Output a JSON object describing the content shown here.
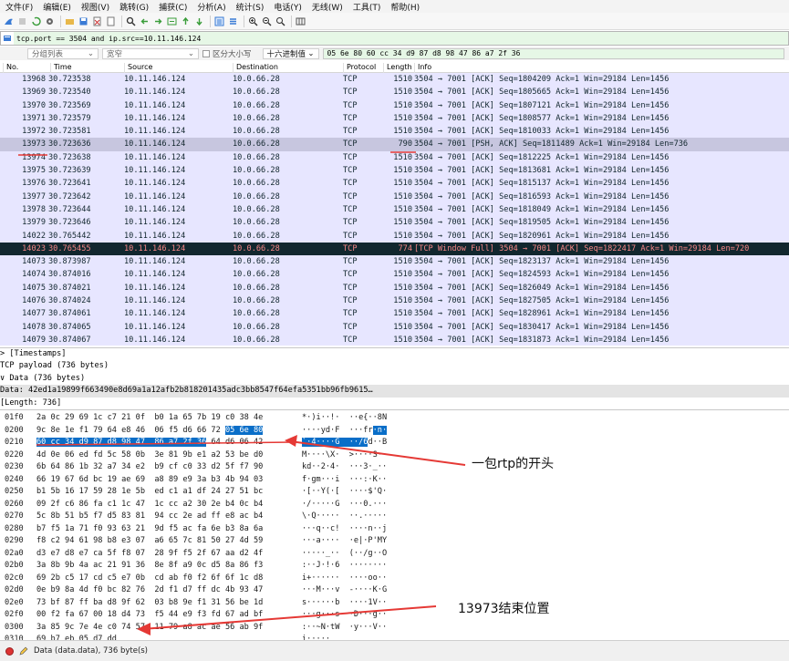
{
  "menu": [
    "文件(F)",
    "编辑(E)",
    "视图(V)",
    "跳转(G)",
    "捕获(C)",
    "分析(A)",
    "统计(S)",
    "电话(Y)",
    "无线(W)",
    "工具(T)",
    "帮助(H)"
  ],
  "toolbar_icons": [
    "shark-fin-icon",
    "stop-icon",
    "restart-icon",
    "options-icon",
    "open-file-icon",
    "save-file-icon",
    "close-file-icon",
    "reload-icon",
    "find-icon",
    "back-icon",
    "forward-icon",
    "jump-icon",
    "first-icon",
    "last-icon",
    "autoscroll-icon",
    "colorize-icon",
    "zoom-in-icon",
    "zoom-out-icon",
    "zoom-reset-icon",
    "resize-columns-icon"
  ],
  "filter": {
    "value": "tcp.port == 3504 and ip.src==10.11.146.124"
  },
  "search": {
    "scope": "分组列表",
    "charset": "宽窄",
    "case_label": "区分大小写",
    "mode": "十六进制值",
    "pattern": "05 6e 80 60 cc 34 d9 87 d8 98 47 86 a7 2f 36"
  },
  "columns": [
    "No.",
    "Time",
    "Source",
    "Destination",
    "Protocol",
    "Length",
    "Info"
  ],
  "packets": [
    {
      "no": "13968",
      "time": "30.723538",
      "src": "10.11.146.124",
      "dst": "10.0.66.28",
      "proto": "TCP",
      "len": "1510",
      "info": "3504 → 7001 [ACK] Seq=1804209 Ack=1 Win=29184 Len=1456",
      "state": "normal"
    },
    {
      "no": "13969",
      "time": "30.723540",
      "src": "10.11.146.124",
      "dst": "10.0.66.28",
      "proto": "TCP",
      "len": "1510",
      "info": "3504 → 7001 [ACK] Seq=1805665 Ack=1 Win=29184 Len=1456",
      "state": "normal"
    },
    {
      "no": "13970",
      "time": "30.723569",
      "src": "10.11.146.124",
      "dst": "10.0.66.28",
      "proto": "TCP",
      "len": "1510",
      "info": "3504 → 7001 [ACK] Seq=1807121 Ack=1 Win=29184 Len=1456",
      "state": "normal"
    },
    {
      "no": "13971",
      "time": "30.723579",
      "src": "10.11.146.124",
      "dst": "10.0.66.28",
      "proto": "TCP",
      "len": "1510",
      "info": "3504 → 7001 [ACK] Seq=1808577 Ack=1 Win=29184 Len=1456",
      "state": "normal"
    },
    {
      "no": "13972",
      "time": "30.723581",
      "src": "10.11.146.124",
      "dst": "10.0.66.28",
      "proto": "TCP",
      "len": "1510",
      "info": "3504 → 7001 [ACK] Seq=1810033 Ack=1 Win=29184 Len=1456",
      "state": "normal"
    },
    {
      "no": "13973",
      "time": "30.723636",
      "src": "10.11.146.124",
      "dst": "10.0.66.28",
      "proto": "TCP",
      "len": "790",
      "info": "3504 → 7001 [PSH, ACK] Seq=1811489 Ack=1 Win=29184 Len=736",
      "state": "selected"
    },
    {
      "no": "13974",
      "time": "30.723638",
      "src": "10.11.146.124",
      "dst": "10.0.66.28",
      "proto": "TCP",
      "len": "1510",
      "info": "3504 → 7001 [ACK] Seq=1812225 Ack=1 Win=29184 Len=1456",
      "state": "normal"
    },
    {
      "no": "13975",
      "time": "30.723639",
      "src": "10.11.146.124",
      "dst": "10.0.66.28",
      "proto": "TCP",
      "len": "1510",
      "info": "3504 → 7001 [ACK] Seq=1813681 Ack=1 Win=29184 Len=1456",
      "state": "normal"
    },
    {
      "no": "13976",
      "time": "30.723641",
      "src": "10.11.146.124",
      "dst": "10.0.66.28",
      "proto": "TCP",
      "len": "1510",
      "info": "3504 → 7001 [ACK] Seq=1815137 Ack=1 Win=29184 Len=1456",
      "state": "normal"
    },
    {
      "no": "13977",
      "time": "30.723642",
      "src": "10.11.146.124",
      "dst": "10.0.66.28",
      "proto": "TCP",
      "len": "1510",
      "info": "3504 → 7001 [ACK] Seq=1816593 Ack=1 Win=29184 Len=1456",
      "state": "normal"
    },
    {
      "no": "13978",
      "time": "30.723644",
      "src": "10.11.146.124",
      "dst": "10.0.66.28",
      "proto": "TCP",
      "len": "1510",
      "info": "3504 → 7001 [ACK] Seq=1818049 Ack=1 Win=29184 Len=1456",
      "state": "normal"
    },
    {
      "no": "13979",
      "time": "30.723646",
      "src": "10.11.146.124",
      "dst": "10.0.66.28",
      "proto": "TCP",
      "len": "1510",
      "info": "3504 → 7001 [ACK] Seq=1819505 Ack=1 Win=29184 Len=1456",
      "state": "normal"
    },
    {
      "no": "14022",
      "time": "30.765442",
      "src": "10.11.146.124",
      "dst": "10.0.66.28",
      "proto": "TCP",
      "len": "1510",
      "info": "3504 → 7001 [ACK] Seq=1820961 Ack=1 Win=29184 Len=1456",
      "state": "normal"
    },
    {
      "no": "14023",
      "time": "30.765455",
      "src": "10.11.146.124",
      "dst": "10.0.66.28",
      "proto": "TCP",
      "len": "774",
      "info": "[TCP Window Full] 3504 → 7001 [ACK] Seq=1822417 Ack=1 Win=29184 Len=720",
      "state": "warning"
    },
    {
      "no": "14073",
      "time": "30.873987",
      "src": "10.11.146.124",
      "dst": "10.0.66.28",
      "proto": "TCP",
      "len": "1510",
      "info": "3504 → 7001 [ACK] Seq=1823137 Ack=1 Win=29184 Len=1456",
      "state": "normal"
    },
    {
      "no": "14074",
      "time": "30.874016",
      "src": "10.11.146.124",
      "dst": "10.0.66.28",
      "proto": "TCP",
      "len": "1510",
      "info": "3504 → 7001 [ACK] Seq=1824593 Ack=1 Win=29184 Len=1456",
      "state": "normal"
    },
    {
      "no": "14075",
      "time": "30.874021",
      "src": "10.11.146.124",
      "dst": "10.0.66.28",
      "proto": "TCP",
      "len": "1510",
      "info": "3504 → 7001 [ACK] Seq=1826049 Ack=1 Win=29184 Len=1456",
      "state": "normal"
    },
    {
      "no": "14076",
      "time": "30.874024",
      "src": "10.11.146.124",
      "dst": "10.0.66.28",
      "proto": "TCP",
      "len": "1510",
      "info": "3504 → 7001 [ACK] Seq=1827505 Ack=1 Win=29184 Len=1456",
      "state": "normal"
    },
    {
      "no": "14077",
      "time": "30.874061",
      "src": "10.11.146.124",
      "dst": "10.0.66.28",
      "proto": "TCP",
      "len": "1510",
      "info": "3504 → 7001 [ACK] Seq=1828961 Ack=1 Win=29184 Len=1456",
      "state": "normal"
    },
    {
      "no": "14078",
      "time": "30.874065",
      "src": "10.11.146.124",
      "dst": "10.0.66.28",
      "proto": "TCP",
      "len": "1510",
      "info": "3504 → 7001 [ACK] Seq=1830417 Ack=1 Win=29184 Len=1456",
      "state": "normal"
    },
    {
      "no": "14079",
      "time": "30.874067",
      "src": "10.11.146.124",
      "dst": "10.0.66.28",
      "proto": "TCP",
      "len": "1510",
      "info": "3504 → 7001 [ACK] Seq=1831873 Ack=1 Win=29184 Len=1456",
      "state": "normal"
    }
  ],
  "details": [
    {
      "text": "  >  [Timestamps]",
      "selected": false
    },
    {
      "text": "     TCP payload (736 bytes)",
      "selected": false
    },
    {
      "text": "∨ Data (736 bytes)",
      "selected": false
    },
    {
      "text": "     Data: 42ed1a19899f663490e8d69a1a12afb2b818201435adc3bb8547f64efa5351bb96fb9615…",
      "selected": true
    },
    {
      "text": "     [Length: 736]",
      "selected": false
    }
  ],
  "bytes": [
    {
      "off": "01f0",
      "hex": "2a 0c 29 69 1c c7 21 0f  b0 1a 65 7b 19 c0 38 4e",
      "ascii": "*·)i··!·  ··e{··8N"
    },
    {
      "off": "0200",
      "hex": "9c 8e 1e f1 79 64 e8 46  06 f5 d6 66 72 ",
      "hex_hl": "05 6e 80",
      "ascii": "····yd·F  ···fr",
      "ascii_hl": "·n·"
    },
    {
      "off": "0210",
      "hex": "",
      "hex_hl": "60 cc 34 d9 87 d8 98 47  86 a7 2f 36",
      "hex_tail": " 64 d6 06 42",
      "ascii": "",
      "ascii_hl": "`·4····G  ··/6",
      "ascii_tail": "d··B"
    },
    {
      "off": "0220",
      "hex": "4d 0e 06 ed fd 5c 58 0b  3e 81 9b e1 a2 53 be d0",
      "ascii": "M····\\X·  >····S··"
    },
    {
      "off": "0230",
      "hex": "6b 64 86 1b 32 a7 34 e2  b9 cf c0 33 d2 5f f7 90",
      "ascii": "kd··2·4·  ···3·_··"
    },
    {
      "off": "0240",
      "hex": "66 19 67 6d bc 19 ae 69  a8 89 e9 3a b3 4b 94 03",
      "ascii": "f·gm···i  ···:·K··"
    },
    {
      "off": "0250",
      "hex": "b1 5b 16 17 59 28 1e 5b  ed c1 a1 df 24 27 51 bc",
      "ascii": "·[··Y(·[  ····$'Q·"
    },
    {
      "off": "0260",
      "hex": "09 2f c6 86 fa c1 1c 47  1c cc a2 30 2e b4 0c b4",
      "ascii": "·/·····G  ···0.···"
    },
    {
      "off": "0270",
      "hex": "5c 8b 51 b5 f7 d5 83 81  94 cc 2e ad ff e8 ac b4",
      "ascii": "\\·Q·····  ··.·····"
    },
    {
      "off": "0280",
      "hex": "b7 f5 1a 71 f0 93 63 21  9d f5 ac fa 6e b3 8a 6a",
      "ascii": "···q··c!  ····n··j"
    },
    {
      "off": "0290",
      "hex": "f8 c2 94 61 98 b8 e3 07  a6 65 7c 81 50 27 4d 59",
      "ascii": "···a····  ·e|·P'MY"
    },
    {
      "off": "02a0",
      "hex": "d3 e7 d8 e7 ca 5f f8 07  28 9f f5 2f 67 aa d2 4f",
      "ascii": "·····_··  (··/g··O"
    },
    {
      "off": "02b0",
      "hex": "3a 8b 9b 4a ac 21 91 36  8e 8f a9 0c d5 8a 86 f3",
      "ascii": ":··J·!·6  ········"
    },
    {
      "off": "02c0",
      "hex": "69 2b c5 17 cd c5 e7 0b  cd ab f0 f2 6f 6f 1c d8",
      "ascii": "i+······  ····oo··"
    },
    {
      "off": "02d0",
      "hex": "0e b9 8a 4d f0 bc 82 76  2d f1 d7 ff dc 4b 93 47",
      "ascii": "···M···v  -····K·G"
    },
    {
      "off": "02e0",
      "hex": "73 bf 87 ff ba d8 9f 62  03 b8 9e f1 31 56 be 1d",
      "ascii": "s······b  ····1V··"
    },
    {
      "off": "02f0",
      "hex": "00 f2 fa 67 00 18 d4 73  f5 44 e9 f3 fd 67 ad bf",
      "ascii": "···g···s  ·D···g··"
    },
    {
      "off": "0300",
      "hex": "3a 85 9c 7e 4e c0 74 57  11 79 a8 ac ae 56 ab 9f",
      "ascii": ":··~N·tW  ·y···V··"
    },
    {
      "off": "0310",
      "hex": "69 b7 eb 05 d7 dd",
      "ascii": "i·····"
    }
  ],
  "status": {
    "text": "Data (data.data), 736 byte(s)"
  },
  "annotations": {
    "rtp_header": "一包rtp的开头",
    "end_position": "13973结束位置"
  },
  "colors": {
    "row_bg": "#e7e6ff",
    "row_selected": "#c7c6df",
    "row_warning_bg": "#12272e",
    "row_warning_fg": "#f78787",
    "highlight": "#0a6ec8",
    "annotation": "#e53935"
  }
}
